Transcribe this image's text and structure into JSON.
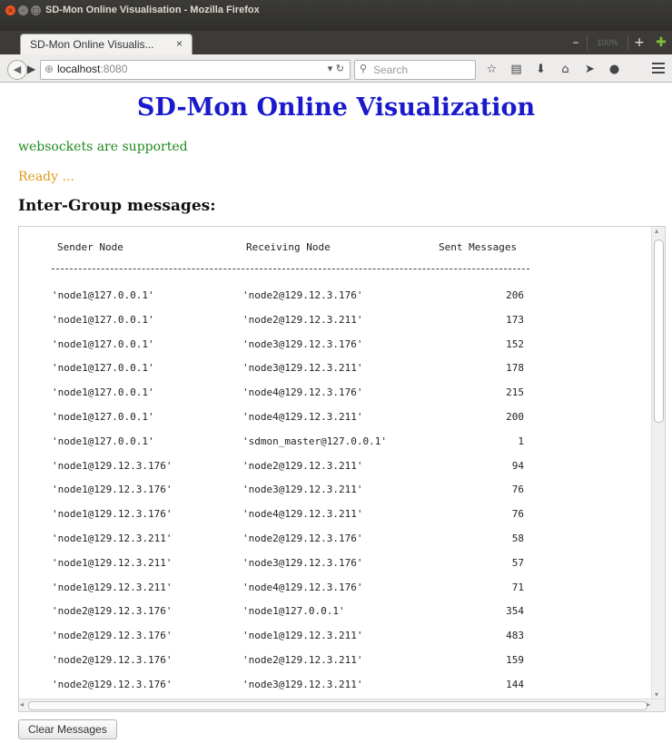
{
  "window": {
    "title": "SD-Mon Online Visualisation - Mozilla Firefox",
    "tab_label": "SD-Mon Online Visualis...",
    "tab_close": "×",
    "zoom": "100%"
  },
  "toolbar": {
    "url_host": "localhost",
    "url_port": ":8080",
    "search_placeholder": "Search"
  },
  "page": {
    "title": "SD-Mon Online Visualization",
    "status_ws": "websockets are supported",
    "status_ready": "Ready ...",
    "section_heading": "Inter-Group messages:",
    "clear_button": "Clear Messages"
  },
  "messages": {
    "headers": [
      "Sender Node",
      "Receiving Node",
      "Sent Messages"
    ],
    "separator": "-------------------------------------------------------------",
    "rows": [
      [
        "'node1@127.0.0.1'",
        "'node2@129.12.3.176'",
        "206"
      ],
      [
        "'node1@127.0.0.1'",
        "'node2@129.12.3.211'",
        "173"
      ],
      [
        "'node1@127.0.0.1'",
        "'node3@129.12.3.176'",
        "152"
      ],
      [
        "'node1@127.0.0.1'",
        "'node3@129.12.3.211'",
        "178"
      ],
      [
        "'node1@127.0.0.1'",
        "'node4@129.12.3.176'",
        "215"
      ],
      [
        "'node1@127.0.0.1'",
        "'node4@129.12.3.211'",
        "200"
      ],
      [
        "'node1@127.0.0.1'",
        "'sdmon_master@127.0.0.1'",
        "1"
      ],
      [
        "'node1@129.12.3.176'",
        "'node2@129.12.3.211'",
        "94"
      ],
      [
        "'node1@129.12.3.176'",
        "'node3@129.12.3.211'",
        "76"
      ],
      [
        "'node1@129.12.3.176'",
        "'node4@129.12.3.211'",
        "76"
      ],
      [
        "'node1@129.12.3.211'",
        "'node2@129.12.3.176'",
        "58"
      ],
      [
        "'node1@129.12.3.211'",
        "'node3@129.12.3.176'",
        "57"
      ],
      [
        "'node1@129.12.3.211'",
        "'node4@129.12.3.176'",
        "71"
      ],
      [
        "'node2@129.12.3.176'",
        "'node1@127.0.0.1'",
        "354"
      ],
      [
        "'node2@129.12.3.176'",
        "'node1@129.12.3.211'",
        "483"
      ],
      [
        "'node2@129.12.3.176'",
        "'node2@129.12.3.211'",
        "159"
      ],
      [
        "'node2@129.12.3.176'",
        "'node3@129.12.3.211'",
        "144"
      ]
    ]
  }
}
